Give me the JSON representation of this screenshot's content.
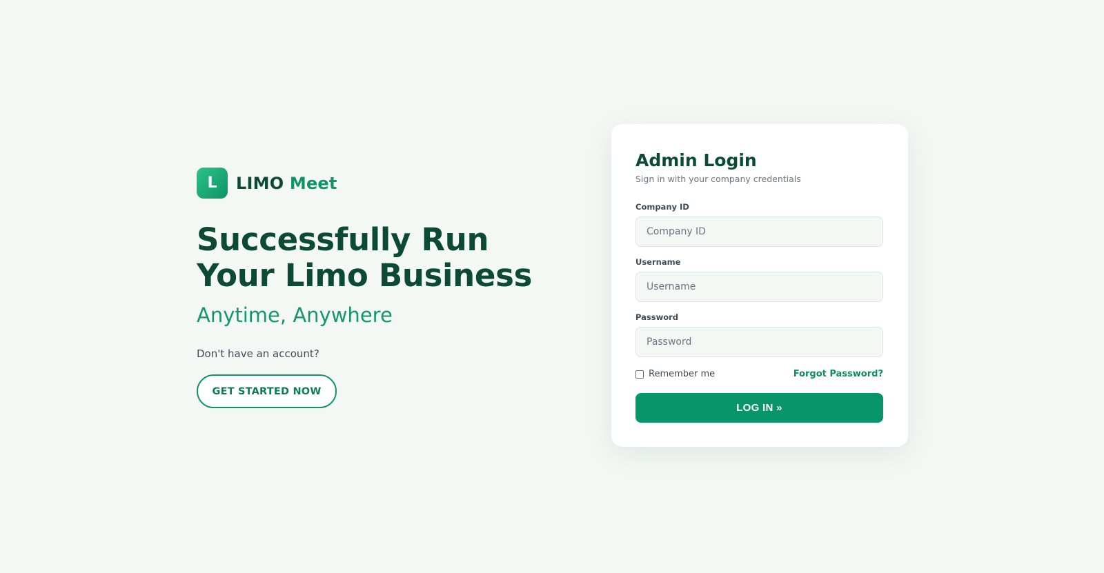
{
  "brand": {
    "logo_letter": "L",
    "name_primary": "LIMO",
    "name_accent": "Meet"
  },
  "hero": {
    "headline": "Successfully Run Your Limo Business",
    "tagline": "Anytime, Anywhere",
    "no_account_text": "Don't have an account?",
    "cta_label": "GET STARTED NOW"
  },
  "login": {
    "title": "Admin Login",
    "subtitle": "Sign in with your company credentials",
    "fields": [
      {
        "label": "Company ID",
        "placeholder": "Company ID",
        "value": ""
      },
      {
        "label": "Username",
        "placeholder": "Username",
        "value": ""
      },
      {
        "label": "Password",
        "placeholder": "Password",
        "value": ""
      }
    ],
    "remember_label": "Remember me",
    "remember_checked": false,
    "forgot_label": "Forgot Password?",
    "submit_label": "LOG IN »"
  },
  "colors": {
    "background": "#f4f8f5",
    "brand_dark": "#0d4a36",
    "brand_accent": "#0e9468",
    "button": "#08956a"
  }
}
